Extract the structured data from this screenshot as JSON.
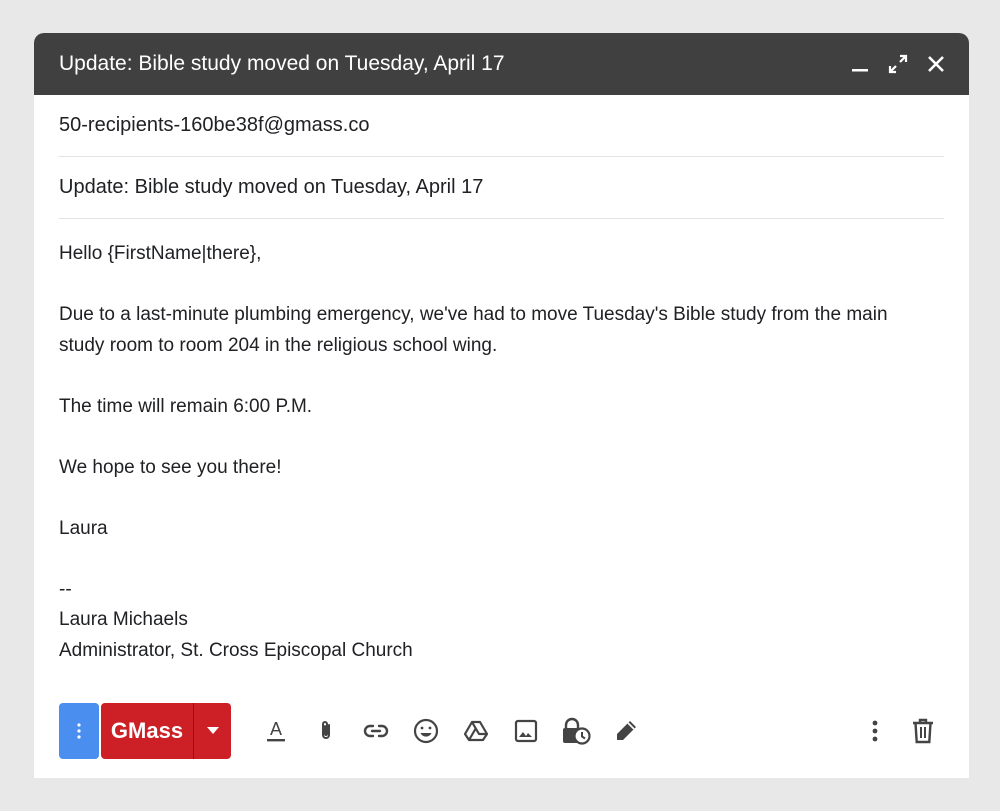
{
  "window": {
    "title": "Update: Bible study moved on Tuesday, April 17",
    "icons": [
      "minimize-icon",
      "fullscreen-icon",
      "close-icon"
    ]
  },
  "recipients": {
    "value": "50-recipients-160be38f@gmass.co"
  },
  "subject": {
    "value": "Update: Bible study moved on Tuesday, April 17"
  },
  "body": {
    "greeting": "Hello {FirstName|there},",
    "paragraph1_line1": "Due to a last-minute plumbing emergency, we've had to move Tuesday's Bible study from the main",
    "paragraph1_line2": "study room to room 204 in the religious school wing.",
    "paragraph2": "The time will remain 6:00 P.M.",
    "paragraph3": "We hope to see you there!",
    "closing": "Laura",
    "sig_separator": "--",
    "sig_name": "Laura Michaels",
    "sig_title": "Administrator, St. Cross Episcopal Church"
  },
  "toolbar": {
    "gmass_label": "GMass",
    "colors": {
      "more": "#4a8ff0",
      "gmass": "#cc1f26",
      "icon": "#444444"
    },
    "icons": [
      "format-text-icon",
      "attach-icon",
      "link-icon",
      "emoji-icon",
      "drive-icon",
      "image-icon",
      "confidential-mode-icon",
      "signature-icon",
      "more-options-icon",
      "trash-icon"
    ]
  }
}
